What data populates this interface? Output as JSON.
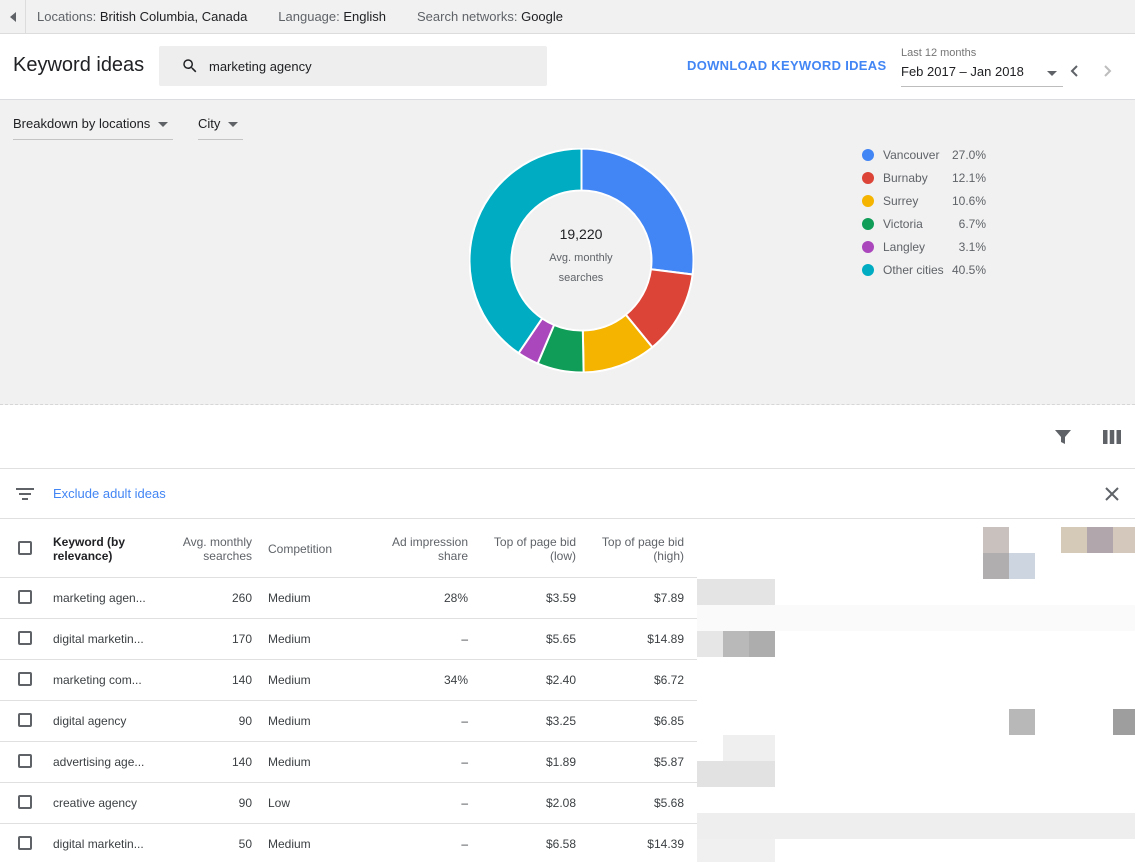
{
  "topbar": {
    "locations_label": "Locations:",
    "locations_value": "British Columbia, Canada",
    "language_label": "Language:",
    "language_value": "English",
    "networks_label": "Search networks:",
    "networks_value": "Google"
  },
  "header": {
    "title": "Keyword ideas",
    "search_value": "marketing agency",
    "download_label": "DOWNLOAD KEYWORD IDEAS",
    "date_label": "Last 12 months",
    "date_value": "Feb 2017 – Jan 2018"
  },
  "breakdown": {
    "primary": "Breakdown by locations",
    "secondary": "City"
  },
  "chart_data": {
    "type": "pie",
    "center_value": "19,220",
    "center_label": "Avg. monthly searches",
    "categories": [
      "Vancouver",
      "Burnaby",
      "Surrey",
      "Victoria",
      "Langley",
      "Other cities"
    ],
    "values": [
      27.0,
      12.1,
      10.6,
      6.7,
      3.1,
      40.5
    ],
    "labels": [
      "27.0%",
      "12.1%",
      "10.6%",
      "6.7%",
      "3.1%",
      "40.5%"
    ],
    "colors": [
      "#4285f4",
      "#db4437",
      "#f4b400",
      "#0f9d58",
      "#ab47bc",
      "#00acc1"
    ],
    "legend_position": "right"
  },
  "filters": {
    "chip": "Exclude adult ideas"
  },
  "table": {
    "headers": {
      "keyword": [
        "Keyword (by",
        "relevance)"
      ],
      "searches": [
        "Avg. monthly",
        "searches"
      ],
      "competition": "Competition",
      "impression": [
        "Ad impression",
        "share"
      ],
      "bid_low": [
        "Top of page bid",
        "(low)"
      ],
      "bid_high": [
        "Top of page bid",
        "(high)"
      ]
    },
    "rows": [
      {
        "keyword": "marketing agen...",
        "searches": "260",
        "competition": "Medium",
        "impression": "28%",
        "low": "$3.59",
        "high": "$7.89"
      },
      {
        "keyword": "digital marketin...",
        "searches": "170",
        "competition": "Medium",
        "impression": "–",
        "low": "$5.65",
        "high": "$14.89"
      },
      {
        "keyword": "marketing com...",
        "searches": "140",
        "competition": "Medium",
        "impression": "34%",
        "low": "$2.40",
        "high": "$6.72"
      },
      {
        "keyword": "digital agency",
        "searches": "90",
        "competition": "Medium",
        "impression": "–",
        "low": "$3.25",
        "high": "$6.85"
      },
      {
        "keyword": "advertising age...",
        "searches": "140",
        "competition": "Medium",
        "impression": "–",
        "low": "$1.89",
        "high": "$5.87"
      },
      {
        "keyword": "creative agency",
        "searches": "90",
        "competition": "Low",
        "impression": "–",
        "low": "$2.08",
        "high": "$5.68"
      },
      {
        "keyword": "digital marketin...",
        "searches": "50",
        "competition": "Medium",
        "impression": "–",
        "low": "$6.58",
        "high": "$14.39"
      }
    ]
  },
  "icons": {
    "back": "chevron-left-icon",
    "search": "search-icon",
    "filter": "filter-funnel-icon",
    "columns": "columns-icon",
    "filter_list": "filter-list-icon",
    "close": "close-icon"
  }
}
